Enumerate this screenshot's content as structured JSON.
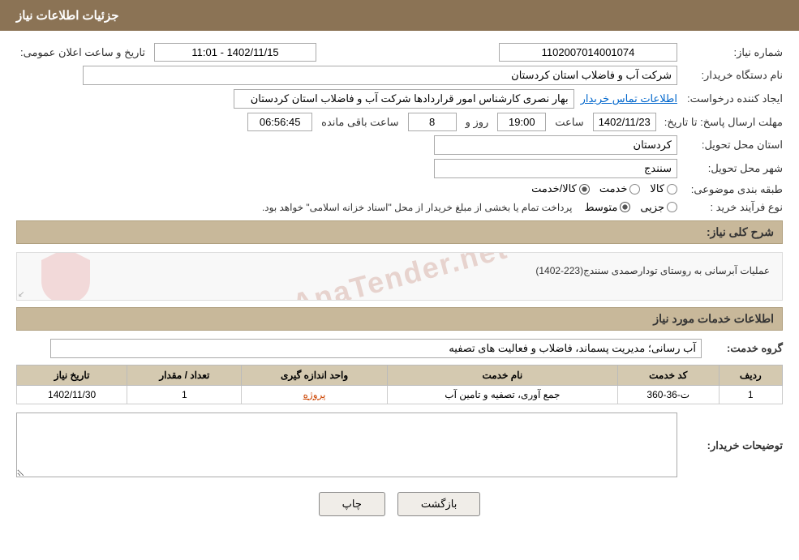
{
  "header": {
    "title": "جزئیات اطلاعات نیاز"
  },
  "needInfo": {
    "needNumber_label": "شماره نیاز:",
    "needNumber_value": "1102007014001074",
    "buyerOrg_label": "نام دستگاه خریدار:",
    "buyerOrg_value": "شرکت آب و فاضلاب استان کردستان",
    "creator_label": "ایجاد کننده درخواست:",
    "creator_value": "بهار نصری کارشناس امور قراردادها شرکت آب و فاضلاب استان کردستان",
    "creatorLink": "اطلاعات تماس خریدار",
    "announceDate_label": "تاریخ و ساعت اعلان عمومی:",
    "announceDate_value": "1402/11/15 - 11:01",
    "answerDeadline_label": "مهلت ارسال پاسخ: تا تاریخ:",
    "answerDate": "1402/11/23",
    "answerTime_label": "ساعت",
    "answerTime": "19:00",
    "answerDays_label": "روز و",
    "answerDays": "8",
    "remainTime_label": "ساعت باقی مانده",
    "remainTime": "06:56:45",
    "deliveryProvince_label": "استان محل تحویل:",
    "deliveryProvince_value": "کردستان",
    "deliveryCity_label": "شهر محل تحویل:",
    "deliveryCity_value": "سنندج",
    "category_label": "طبقه بندی موضوعی:",
    "category_options": [
      "کالا",
      "خدمت",
      "کالا/خدمت"
    ],
    "category_selected": "کالا/خدمت",
    "processType_label": "نوع فرآیند خرید :",
    "processType_options": [
      "جزیی",
      "متوسط"
    ],
    "processType_selected": "متوسط",
    "processType_note": "پرداخت تمام یا بخشی از مبلغ خریدار از محل \"اسناد خزانه اسلامی\" خواهد بود.",
    "needDesc_label": "شرح کلی نیاز:",
    "needDesc_value": "عملیات آبرسانی به روستای تودارصمدی سنندج(223-1402)",
    "servicesInfo_label": "اطلاعات خدمات مورد نیاز",
    "serviceGroup_label": "گروه خدمت:",
    "serviceGroup_value": "آب رسانی؛ مدیریت پسماند، فاضلاب و فعالیت های تصفیه",
    "table": {
      "headers": [
        "ردیف",
        "کد خدمت",
        "نام خدمت",
        "واحد اندازه گیری",
        "تعداد / مقدار",
        "تاریخ نیاز"
      ],
      "rows": [
        {
          "row": "1",
          "code": "ت-36-360",
          "name": "جمع آوری، تصفیه و تامین آب",
          "unit": "پروژه",
          "qty": "1",
          "date": "1402/11/30"
        }
      ]
    },
    "buyerNotes_label": "توضیحات خریدار:",
    "buyerNotes_value": "",
    "btn_back": "بازگشت",
    "btn_print": "چاپ"
  }
}
